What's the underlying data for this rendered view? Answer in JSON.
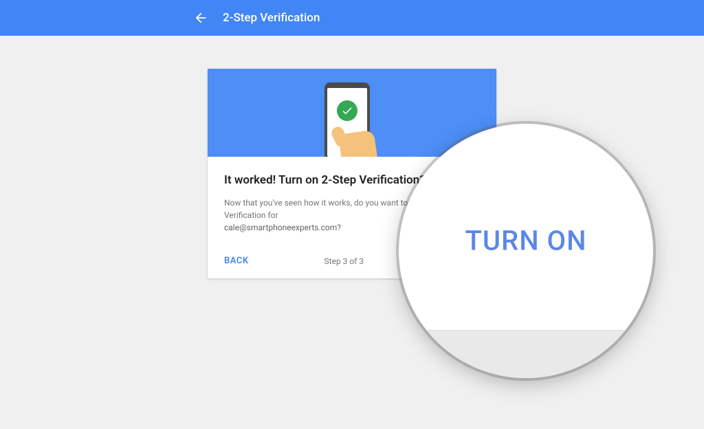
{
  "header": {
    "title": "2-Step Verification"
  },
  "card": {
    "heading": "It worked! Turn on 2-Step Verification?",
    "description": "Now that you've seen how it works, do you want to turn on 2-Step Verification for",
    "email": "cale@smartphoneexperts.com?",
    "back_label": "BACK",
    "step_text": "Step 3 of 3",
    "turn_on_label": "TURN ON"
  },
  "magnifier": {
    "text": "TURN ON"
  },
  "colors": {
    "primary_blue": "#4285f4",
    "banner_blue": "#4d8ef7",
    "success_green": "#34a853"
  }
}
